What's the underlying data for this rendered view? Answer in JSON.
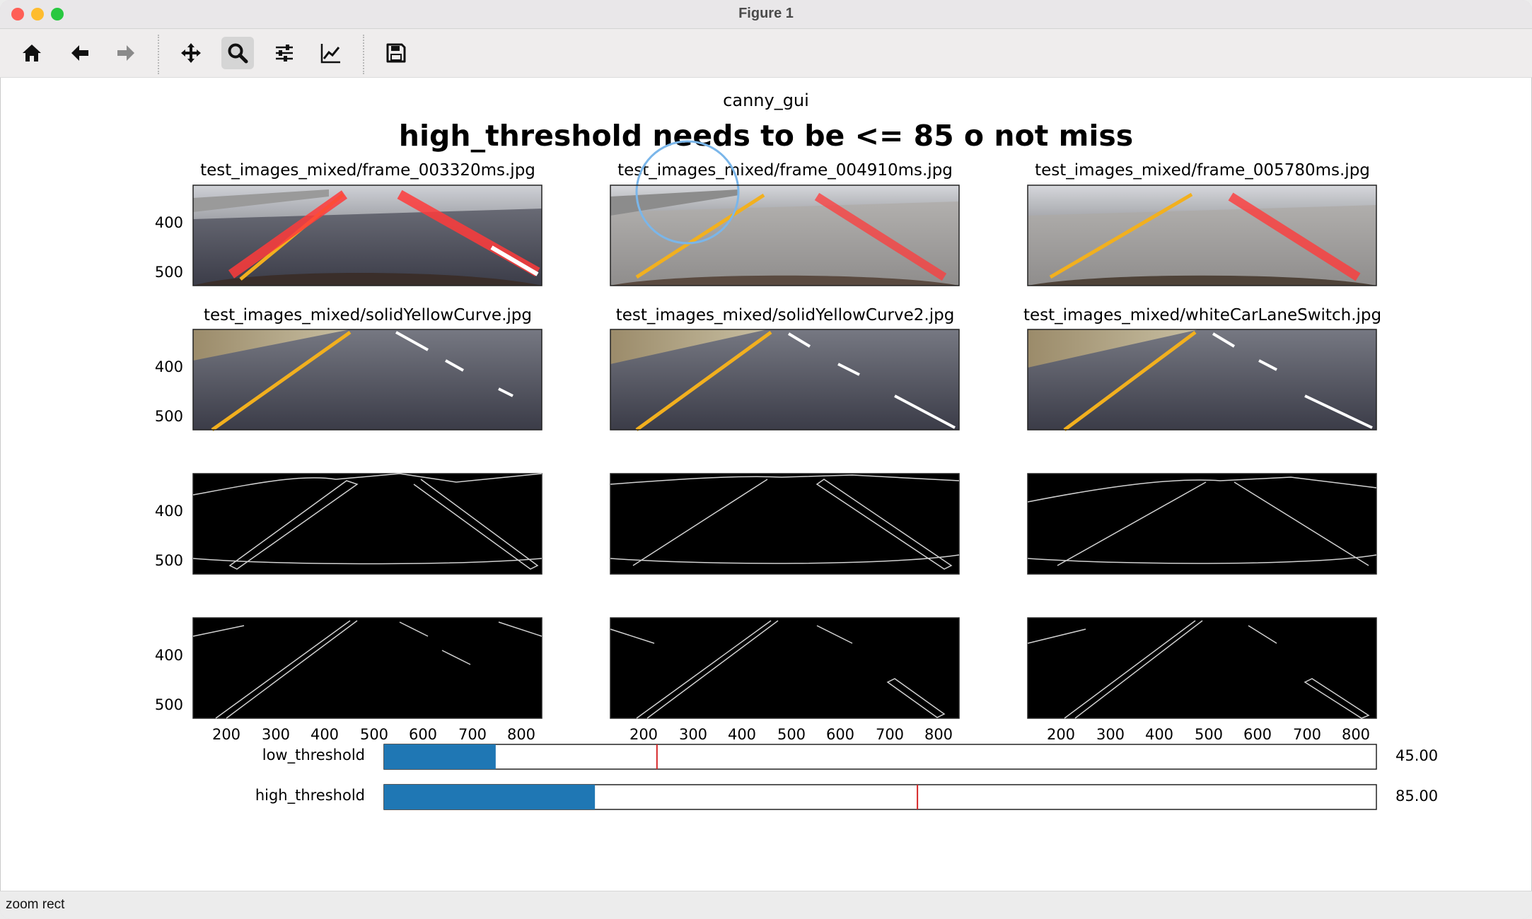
{
  "window": {
    "title": "Figure 1"
  },
  "toolbar": {
    "buttons": [
      {
        "name": "home-button",
        "icon": "home-icon"
      },
      {
        "name": "back-button",
        "icon": "arrow-left-icon"
      },
      {
        "name": "forward-button",
        "icon": "arrow-right-icon"
      },
      {
        "name": "pan-button",
        "icon": "move-icon"
      },
      {
        "name": "zoom-button",
        "icon": "magnifier-icon",
        "active": true
      },
      {
        "name": "subplots-button",
        "icon": "sliders-icon"
      },
      {
        "name": "axes-button",
        "icon": "line-chart-icon"
      },
      {
        "name": "save-button",
        "icon": "floppy-disk-icon"
      }
    ]
  },
  "figure": {
    "suptitle": "canny_gui",
    "overlay_title": "high_threshold needs to be <= 85 o not miss",
    "panels_row1": [
      "test_images_mixed/frame_003320ms.jpg",
      "test_images_mixed/frame_004910ms.jpg",
      "test_images_mixed/frame_005780ms.jpg"
    ],
    "panels_row2": [
      "test_images_mixed/solidYellowCurve.jpg",
      "test_images_mixed/solidYellowCurve2.jpg",
      "test_images_mixed/whiteCarLaneSwitch.jpg"
    ],
    "ytick_labels": [
      "400",
      "500"
    ],
    "xtick_labels": [
      "200",
      "300",
      "400",
      "500",
      "600",
      "700",
      "800"
    ]
  },
  "sliders": {
    "low": {
      "label": "low_threshold",
      "value_text": "45.00",
      "fill_fraction": 0.1125,
      "marker_fraction": 0.275
    },
    "high": {
      "label": "high_threshold",
      "value_text": "85.00",
      "fill_fraction": 0.2125,
      "marker_fraction": 0.5375
    }
  },
  "status": {
    "text": "zoom rect"
  },
  "colors": {
    "slider_fill": "#1f77b4",
    "slider_marker": "#d62728",
    "lane_red": "#ff3b3b",
    "lane_yellow": "#f2b01e"
  }
}
